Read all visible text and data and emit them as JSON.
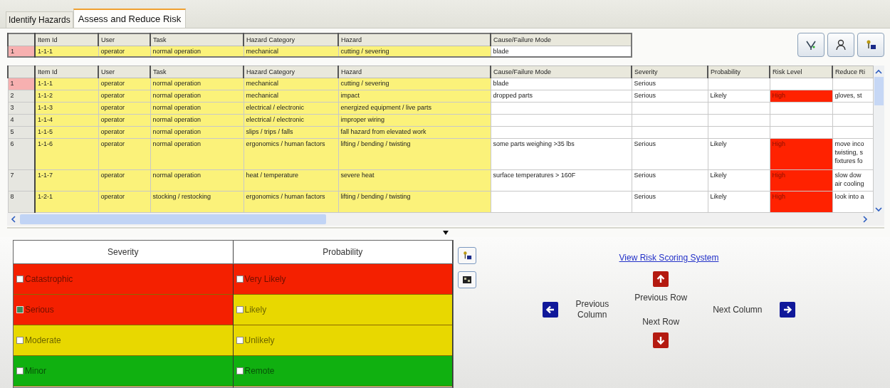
{
  "tabs": [
    {
      "label": "Identify Hazards",
      "selected": false
    },
    {
      "label": "Assess and Reduce Risk",
      "selected": true
    }
  ],
  "current_row": {
    "columns": [
      "Item Id",
      "User",
      "Task",
      "Hazard Category",
      "Hazard",
      "Cause/Failure Mode"
    ],
    "number": "1",
    "cells": [
      "1-1-1",
      "operator",
      "normal operation",
      "mechanical",
      "cutting / severing",
      "blade"
    ]
  },
  "grid": {
    "columns": [
      "Item Id",
      "User",
      "Task",
      "Hazard Category",
      "Hazard",
      "Cause/Failure Mode",
      "Severity",
      "Probability",
      "Risk Level",
      "Reduce Ri"
    ],
    "rows": [
      {
        "number": "1",
        "selected": true,
        "cells": [
          "1-1-1",
          "operator",
          "normal operation",
          "mechanical",
          "cutting / severing",
          "blade",
          "Serious",
          "",
          "",
          ""
        ]
      },
      {
        "number": "2",
        "selected": false,
        "color": "#ff2200",
        "cells": [
          "1-1-2",
          "operator",
          "normal operation",
          "mechanical",
          "impact",
          "dropped parts",
          "Serious",
          "Likely",
          "High",
          "gloves, st"
        ]
      },
      {
        "number": "3",
        "selected": false,
        "cells": [
          "1-1-3",
          "operator",
          "normal operation",
          "electrical / electronic",
          "energized equipment / live parts",
          "",
          "",
          "",
          "",
          ""
        ]
      },
      {
        "number": "4",
        "selected": false,
        "cells": [
          "1-1-4",
          "operator",
          "normal operation",
          "electrical / electronic",
          "improper wiring",
          "",
          "",
          "",
          "",
          ""
        ]
      },
      {
        "number": "5",
        "selected": false,
        "cells": [
          "1-1-5",
          "operator",
          "normal operation",
          "slips / trips / falls",
          "fall hazard from elevated work",
          "",
          "",
          "",
          "",
          ""
        ]
      },
      {
        "number": "6",
        "selected": false,
        "color": "#ff2200",
        "cells": [
          "1-1-6",
          "operator",
          "normal operation",
          "ergonomics / human factors",
          "lifting / bending / twisting",
          "some parts weighing >35 lbs",
          "Serious",
          "Likely",
          "High",
          "move inco\ntwisting, s\nfixtures fo"
        ]
      },
      {
        "number": "7",
        "selected": false,
        "color": "#ff2200",
        "cells": [
          "1-1-7",
          "operator",
          "normal operation",
          "heat / temperature",
          "severe heat",
          "surface temperatures > 160F",
          "Serious",
          "Likely",
          "High",
          "slow dow\nair cooling"
        ]
      },
      {
        "number": "8",
        "selected": false,
        "color": "#ff2200",
        "cells": [
          "1-2-1",
          "operator",
          "stocking / restocking",
          "ergonomics / human factors",
          "lifting / bending / twisting",
          "",
          "Serious",
          "Likely",
          "High",
          "look into a"
        ]
      }
    ]
  },
  "rating": {
    "columns": [
      "Severity",
      "Probability"
    ],
    "severity": [
      {
        "label": "Catastrophic",
        "checked": false,
        "color": "#f42000"
      },
      {
        "label": "Serious",
        "checked": true,
        "color": "#f42000"
      },
      {
        "label": "Moderate",
        "checked": false,
        "color": "#e8d800"
      },
      {
        "label": "Minor",
        "checked": false,
        "color": "#10b010"
      }
    ],
    "probability": [
      {
        "label": "Very Likely",
        "checked": false,
        "color": "#f42000"
      },
      {
        "label": "Likely",
        "checked": false,
        "color": "#e8d800"
      },
      {
        "label": "Unlikely",
        "checked": false,
        "color": "#e8d800"
      },
      {
        "label": "Remote",
        "checked": false,
        "color": "#10b010"
      }
    ]
  },
  "navigation": {
    "link": "View Risk Scoring System",
    "previous_row": "Previous Row",
    "next_row": "Next Row",
    "previous_column": "Previous\nColumn",
    "next_column": "Next Column"
  }
}
